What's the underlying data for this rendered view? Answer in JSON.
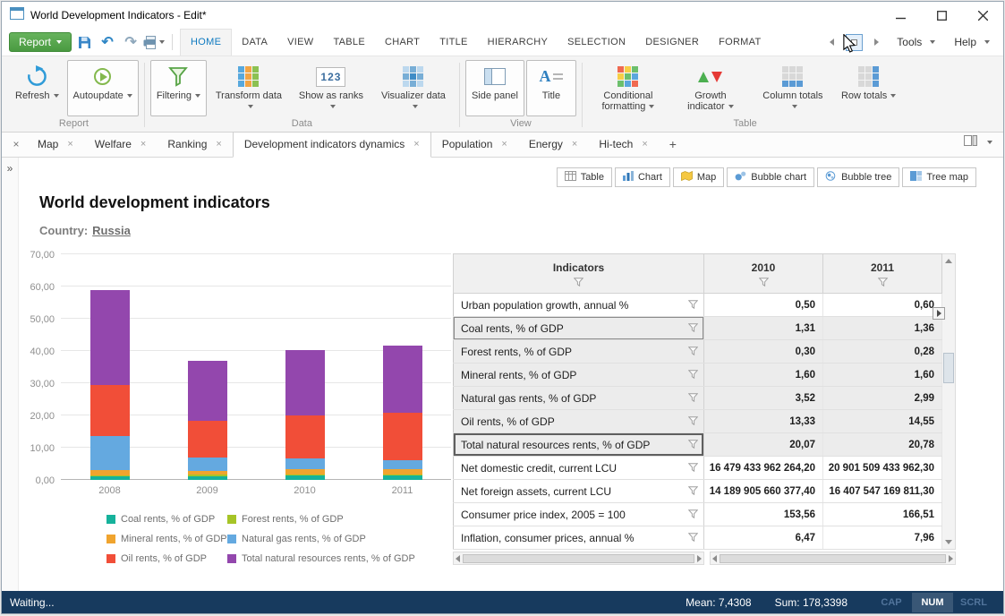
{
  "window": {
    "title": "World Development Indicators - Edit*"
  },
  "menubar": {
    "report_button": "Report",
    "tabs": [
      "HOME",
      "DATA",
      "VIEW",
      "TABLE",
      "CHART",
      "TITLE",
      "HIERARCHY",
      "SELECTION",
      "DESIGNER",
      "FORMAT"
    ],
    "active_tab": "HOME",
    "tools": "Tools",
    "help": "Help"
  },
  "ribbon": {
    "groups": [
      {
        "label": "Report",
        "buttons": [
          {
            "label": "Refresh",
            "icon": "refresh-icon",
            "dropdown": true,
            "selected": false
          },
          {
            "label": "Autoupdate",
            "icon": "autoupdate-icon",
            "dropdown": true,
            "selected": true
          }
        ]
      },
      {
        "label": "Data",
        "buttons": [
          {
            "label": "Filtering",
            "icon": "filtering-icon",
            "dropdown": true,
            "selected": true
          },
          {
            "label": "Transform data",
            "icon": "transform-data-icon",
            "dropdown": true,
            "selected": false
          },
          {
            "label": "Show as ranks",
            "icon": "show-as-ranks-icon",
            "dropdown": true,
            "selected": false
          },
          {
            "label": "Visualizer data",
            "icon": "visualizer-data-icon",
            "dropdown": true,
            "selected": false
          }
        ]
      },
      {
        "label": "View",
        "buttons": [
          {
            "label": "Side panel",
            "icon": "side-panel-icon",
            "dropdown": false,
            "selected": true
          },
          {
            "label": "Title",
            "icon": "title-icon",
            "dropdown": false,
            "selected": true
          }
        ]
      },
      {
        "label": "Table",
        "buttons": [
          {
            "label": "Conditional formatting",
            "icon": "conditional-formatting-icon",
            "dropdown": true,
            "selected": false
          },
          {
            "label": "Growth indicator",
            "icon": "growth-indicator-icon",
            "dropdown": true,
            "selected": false
          },
          {
            "label": "Column totals",
            "icon": "column-totals-icon",
            "dropdown": true,
            "selected": false
          },
          {
            "label": "Row totals",
            "icon": "row-totals-icon",
            "dropdown": true,
            "selected": false
          }
        ]
      }
    ]
  },
  "doc_tabs": {
    "tabs": [
      {
        "label": "Map",
        "active": false
      },
      {
        "label": "Welfare",
        "active": false
      },
      {
        "label": "Ranking",
        "active": false
      },
      {
        "label": "Development indicators dynamics",
        "active": true
      },
      {
        "label": "Population",
        "active": false
      },
      {
        "label": "Energy",
        "active": false
      },
      {
        "label": "Hi-tech",
        "active": false
      }
    ],
    "add_button": "+",
    "close_glyph": "×",
    "collapse_glyph": "»"
  },
  "view_switcher": [
    {
      "label": "Table",
      "icon": "table-view-icon"
    },
    {
      "label": "Chart",
      "icon": "chart-view-icon"
    },
    {
      "label": "Map",
      "icon": "map-view-icon"
    },
    {
      "label": "Bubble chart",
      "icon": "bubble-chart-view-icon"
    },
    {
      "label": "Bubble tree",
      "icon": "bubble-tree-view-icon"
    },
    {
      "label": "Tree map",
      "icon": "tree-map-view-icon"
    }
  ],
  "report_header": {
    "title": "World development indicators",
    "country_label": "Country:",
    "country_value": "Russia"
  },
  "chart_data": {
    "type": "bar",
    "stacked": true,
    "title": "World development indicators",
    "categories": [
      "2008",
      "2009",
      "2010",
      "2011"
    ],
    "series": [
      {
        "name": "Coal rents, % of GDP",
        "color": "#16b29b",
        "values": [
          1.0,
          1.2,
          1.31,
          1.36
        ]
      },
      {
        "name": "Forest rents, % of GDP",
        "color": "#a6c427",
        "values": [
          0.3,
          0.4,
          0.3,
          0.28
        ]
      },
      {
        "name": "Mineral rents, % of GDP",
        "color": "#f0a42e",
        "values": [
          1.7,
          1.2,
          1.6,
          1.6
        ]
      },
      {
        "name": "Natural gas rents, % of GDP",
        "color": "#64a9e0",
        "values": [
          10.5,
          4.2,
          3.52,
          2.99
        ]
      },
      {
        "name": "Oil rents, % of GDP",
        "color": "#f14e38",
        "values": [
          16.0,
          11.5,
          13.33,
          14.55
        ]
      },
      {
        "name": "Total natural resources rents, % of GDP",
        "color": "#9347ad",
        "values": [
          29.5,
          18.5,
          20.07,
          20.78
        ]
      }
    ],
    "ylim": [
      0,
      70
    ],
    "ytick_labels": [
      "0,00",
      "10,00",
      "20,00",
      "30,00",
      "40,00",
      "50,00",
      "60,00",
      "70,00"
    ],
    "grid": true,
    "legend_position": "bottom"
  },
  "table": {
    "columns": [
      "Indicators",
      "2010",
      "2011"
    ],
    "rows": [
      {
        "name": "Urban population growth, annual %",
        "values": [
          "0,50",
          "0,60"
        ],
        "highlighted": false,
        "name_focused": false,
        "selected": false
      },
      {
        "name": "Coal rents, % of GDP",
        "values": [
          "1,31",
          "1,36"
        ],
        "highlighted": true,
        "name_focused": true,
        "selected": false
      },
      {
        "name": "Forest rents, % of GDP",
        "values": [
          "0,30",
          "0,28"
        ],
        "highlighted": true,
        "name_focused": false,
        "selected": false
      },
      {
        "name": "Mineral rents, % of GDP",
        "values": [
          "1,60",
          "1,60"
        ],
        "highlighted": true,
        "name_focused": false,
        "selected": false
      },
      {
        "name": "Natural gas rents, % of GDP",
        "values": [
          "3,52",
          "2,99"
        ],
        "highlighted": true,
        "name_focused": false,
        "selected": false
      },
      {
        "name": "Oil rents, % of GDP",
        "values": [
          "13,33",
          "14,55"
        ],
        "highlighted": true,
        "name_focused": false,
        "selected": false
      },
      {
        "name": "Total natural resources rents, % of GDP",
        "values": [
          "20,07",
          "20,78"
        ],
        "highlighted": true,
        "name_focused": false,
        "selected": true
      },
      {
        "name": "Net domestic credit, current LCU",
        "values": [
          "16 479 433 962 264,20",
          "20 901 509 433 962,30"
        ],
        "highlighted": false,
        "name_focused": false,
        "selected": false
      },
      {
        "name": "Net foreign assets, current LCU",
        "values": [
          "14 189 905 660 377,40",
          "16 407 547 169 811,30"
        ],
        "highlighted": false,
        "name_focused": false,
        "selected": false
      },
      {
        "name": "Consumer price index, 2005 = 100",
        "values": [
          "153,56",
          "166,51"
        ],
        "highlighted": false,
        "name_focused": false,
        "selected": false
      },
      {
        "name": "Inflation, consumer prices, annual %",
        "values": [
          "6,47",
          "7,96"
        ],
        "highlighted": false,
        "name_focused": false,
        "selected": false
      }
    ]
  },
  "status_bar": {
    "left": "Waiting...",
    "mean_label": "Mean:",
    "mean_value": "7,4308",
    "sum_label": "Sum:",
    "sum_value": "178,3398",
    "toggles": [
      {
        "label": "CAP",
        "active": false
      },
      {
        "label": "NUM",
        "active": true
      },
      {
        "label": "SCRL",
        "active": false
      }
    ]
  }
}
